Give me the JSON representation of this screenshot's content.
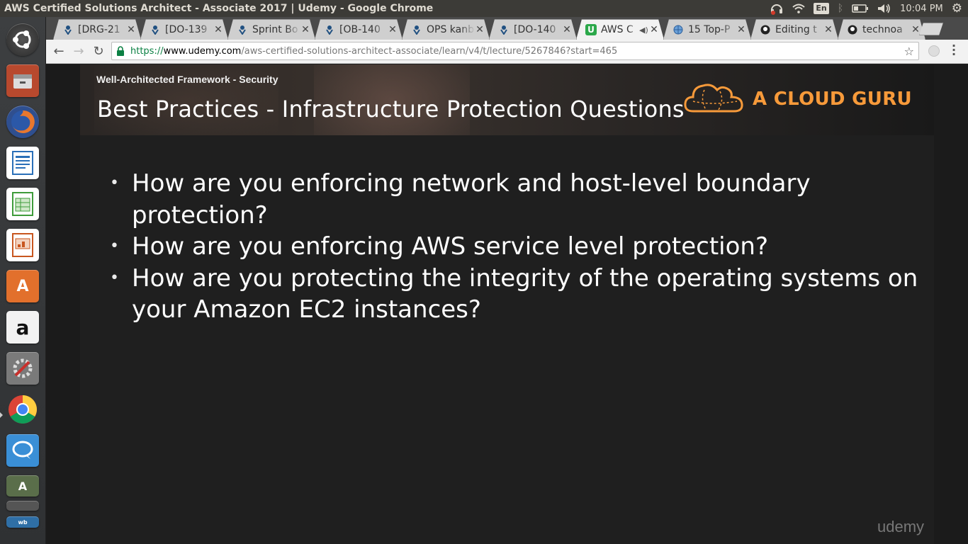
{
  "window": {
    "title": "AWS Certified Solutions Architect - Associate 2017 | Udemy - Google Chrome"
  },
  "tray": {
    "language": "En",
    "clock": "10:04 PM"
  },
  "launcher": {
    "apps": [
      {
        "name": "ubuntu-dash-icon",
        "color": "#2c2c2c"
      },
      {
        "name": "files-icon",
        "color": "#b85a3a"
      },
      {
        "name": "firefox-icon",
        "color": "#e0642a"
      },
      {
        "name": "writer-icon",
        "color": "#2a6fb8"
      },
      {
        "name": "calc-icon",
        "color": "#3e9b3a"
      },
      {
        "name": "impress-icon",
        "color": "#c8561f"
      },
      {
        "name": "software-center-icon",
        "color": "#e87a2e"
      },
      {
        "name": "amazon-icon",
        "color": "#f0f0f0"
      },
      {
        "name": "system-settings-icon",
        "color": "#6b6b6b"
      },
      {
        "name": "chrome-icon",
        "color": "#4a9a4a"
      },
      {
        "name": "chat-icon",
        "color": "#3a8fd6"
      },
      {
        "name": "workspace-switcher-icon",
        "color": "#5a6e4a"
      },
      {
        "name": "workbench-icon",
        "color": "#2f6fa6"
      }
    ]
  },
  "tabs": [
    {
      "label": "[DRG-21",
      "icon": "jira-icon",
      "active": false
    },
    {
      "label": "[DO-139",
      "icon": "jira-icon",
      "active": false
    },
    {
      "label": "Sprint Bo",
      "icon": "jira-icon",
      "active": false
    },
    {
      "label": "[OB-140",
      "icon": "jira-icon",
      "active": false
    },
    {
      "label": "OPS kanb",
      "icon": "jira-icon",
      "active": false
    },
    {
      "label": "[DO-140",
      "icon": "jira-icon",
      "active": false
    },
    {
      "label": "AWS C",
      "icon": "udemy-icon",
      "active": true
    },
    {
      "label": "15 Top-P",
      "icon": "globe-icon",
      "active": false
    },
    {
      "label": "Editing t",
      "icon": "github-icon",
      "active": false
    },
    {
      "label": "technoa",
      "icon": "github-icon",
      "active": false
    }
  ],
  "toolbar": {
    "url_scheme": "https://",
    "url_host": "www.udemy.com",
    "url_path": "/aws-certified-solutions-architect-associate/learn/v4/t/lecture/5267846?start=465"
  },
  "slide": {
    "kicker": "Well-Architected Framework - Security",
    "title": "Best Practices - Infrastructure Protection Questions",
    "brand": "A CLOUD GURU",
    "brand_color": "#f79a3a",
    "bullets": [
      "How are you enforcing network and host-level boundary protection?",
      "How are you enforcing AWS service level protection?",
      "How are you protecting the integrity of the operating systems on your Amazon EC2 instances?"
    ],
    "watermark": "udemy"
  }
}
